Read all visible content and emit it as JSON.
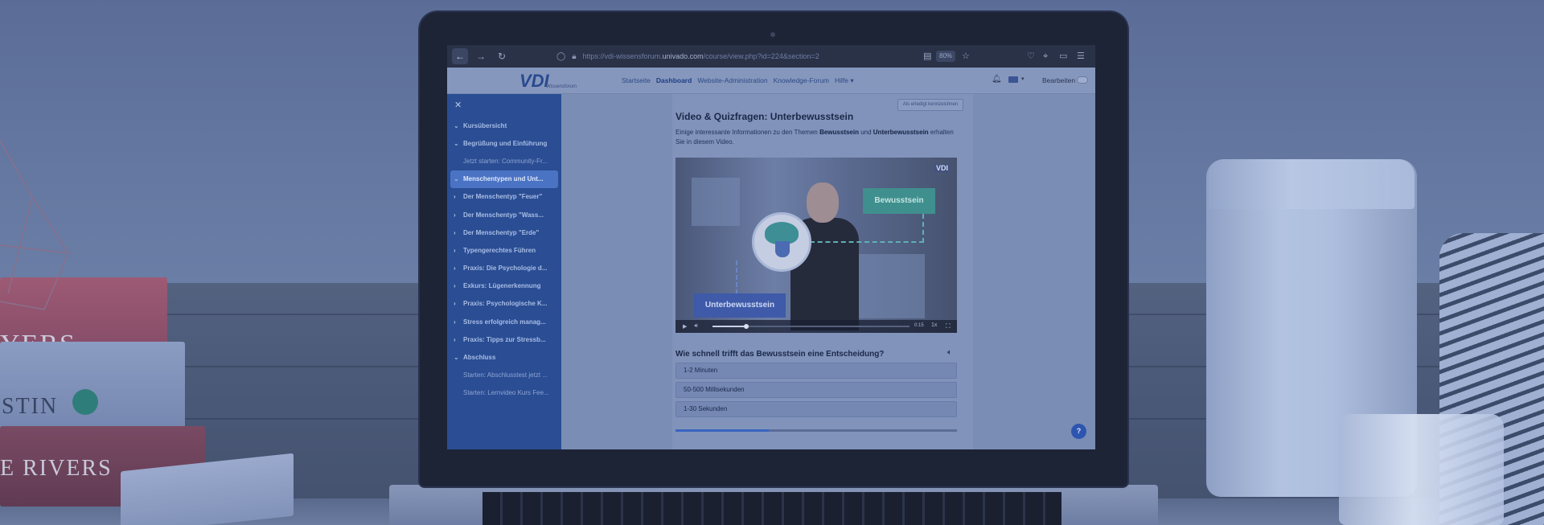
{
  "browser": {
    "url_prefix": "https://vdi-wissensforum.",
    "url_host": "univado.com",
    "url_path": "/course/view.php?id=224&section=2",
    "zoom": "80%"
  },
  "site": {
    "logo": "VDI",
    "logo_sub": "Wissensforum",
    "nav": [
      "Startseite",
      "Dashboard",
      "Website-Administration",
      "Knowledge-Forum",
      "Hilfe"
    ],
    "nav_active": "Dashboard",
    "edit_label": "Bearbeiten"
  },
  "sidebar": {
    "items": [
      {
        "label": "Kursübersicht",
        "chevron": "down",
        "type": "section"
      },
      {
        "label": "Begrüßung und Einführung",
        "chevron": "down",
        "type": "section"
      },
      {
        "label": "Jetzt starten: Community-Fr...",
        "chevron": "",
        "type": "sub"
      },
      {
        "label": "Menschentypen und Unt...",
        "chevron": "down",
        "type": "section",
        "active": true
      },
      {
        "label": "Der Menschentyp \"Feuer\"",
        "chevron": "right",
        "type": "section"
      },
      {
        "label": "Der Menschentyp \"Wass...",
        "chevron": "right",
        "type": "section"
      },
      {
        "label": "Der Menschentyp \"Erde\"",
        "chevron": "right",
        "type": "section"
      },
      {
        "label": "Typengerechtes Führen",
        "chevron": "right",
        "type": "section"
      },
      {
        "label": "Praxis: Die Psychologie d...",
        "chevron": "right",
        "type": "section"
      },
      {
        "label": "Exkurs: Lügenerkennung",
        "chevron": "right",
        "type": "section"
      },
      {
        "label": "Praxis: Psychologische K...",
        "chevron": "right",
        "type": "section"
      },
      {
        "label": "Stress erfolgreich manag...",
        "chevron": "right",
        "type": "section"
      },
      {
        "label": "Praxis: Tipps zur Stressb...",
        "chevron": "right",
        "type": "section"
      },
      {
        "label": "Abschluss",
        "chevron": "down",
        "type": "section"
      },
      {
        "label": "Starten: Abschlusstest jetzt ...",
        "chevron": "",
        "type": "sub"
      },
      {
        "label": "Starten: Lernvideo Kurs Fee...",
        "chevron": "",
        "type": "sub"
      }
    ]
  },
  "main": {
    "mark_done": "Als erledigt kennzeichnen",
    "title": "Video & Quizfragen: Unterbewusstsein",
    "intro_1": "Einige interessante Informationen zu den Themen ",
    "intro_b1": "Bewusstsein",
    "intro_2": " und ",
    "intro_b2": "Unterbewusstsein",
    "intro_3": " erhalten Sie in diesem Video."
  },
  "video": {
    "tag_top": "Bewusstsein",
    "tag_bottom": "Unterbewusstsein",
    "watermark": "VDI",
    "time": "0:15",
    "speed": "1x",
    "progress": 0.17
  },
  "quiz": {
    "question": "Wie schnell trifft das Bewusstsein eine Entscheidung?",
    "options": [
      "1-2 Minuten",
      "50-500 Millisekunden",
      "1-30 Sekunden"
    ],
    "progress": 0.33
  },
  "help": "?"
}
